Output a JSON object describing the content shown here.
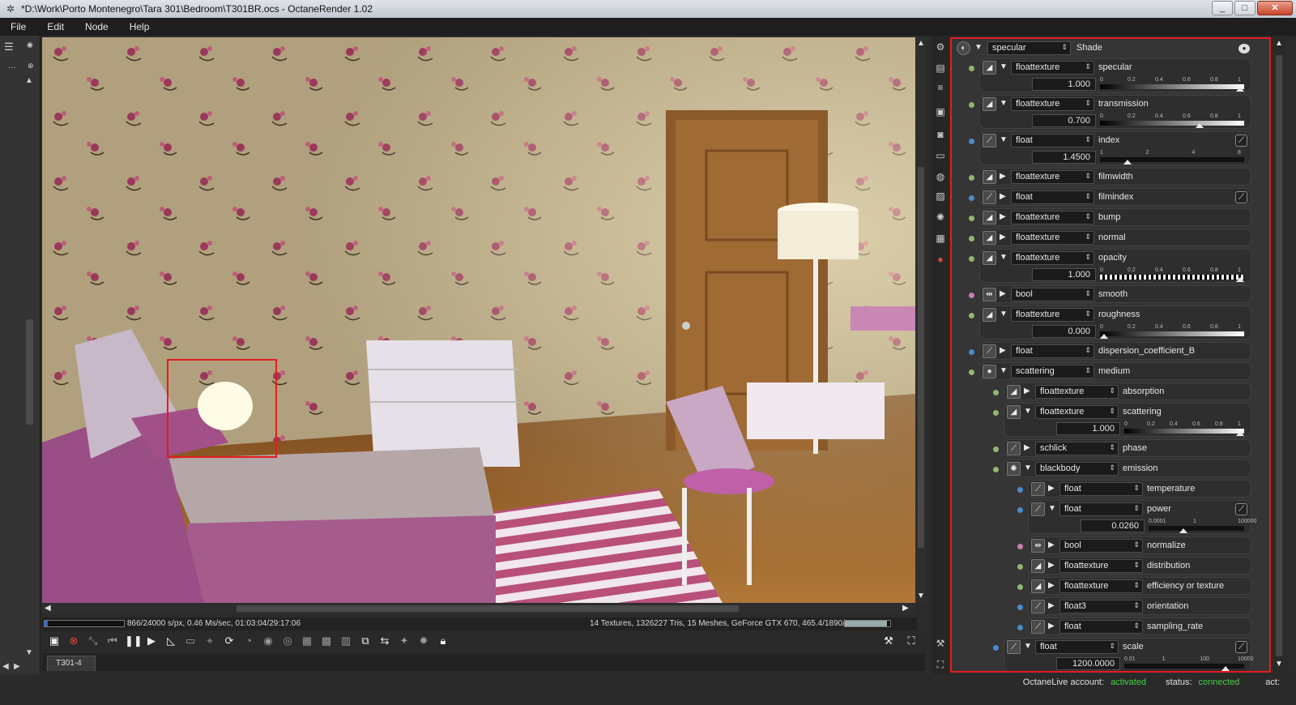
{
  "window": {
    "title": "*D:\\Work\\Porto Montenegro\\Tara 301\\Bedroom\\T301BR.ocs - OctaneRender 1.02",
    "min": "_",
    "max": "□",
    "close": "✕"
  },
  "menu": [
    "File",
    "Edit",
    "Node",
    "Help"
  ],
  "status": {
    "progress_fraction": 0.036,
    "left_text": "866/24000 s/px, 0.46 Ms/sec, 01:03:04/29:17:06",
    "right_text": "14 Textures, 1326227 Tris, 15 Meshes, GeForce GTX 670, 465.4/1890/2048 MB",
    "gpu_mem_fraction": 0.92
  },
  "tab": {
    "label": "T301-4"
  },
  "footer": {
    "account_label": "OctaneLive account:",
    "account_value": "activated",
    "status_label": "status:",
    "status_value": "connected",
    "act_label": "act:"
  },
  "panel": {
    "root": {
      "type": "specular",
      "label": "Shade"
    },
    "rows": [
      {
        "type": "floattexture",
        "label": "specular",
        "expanded": true,
        "value": "1.000",
        "slider": "grad",
        "knob": 1.0,
        "ticks": [
          "0",
          "0.2",
          "0.4",
          "0.6",
          "0.8",
          "1"
        ]
      },
      {
        "type": "floattexture",
        "label": "transmission",
        "expanded": true,
        "value": "0.700",
        "slider": "grad",
        "knob": 0.7,
        "ticks": [
          "0",
          "0.2",
          "0.4",
          "0.6",
          "0.8",
          "1"
        ]
      },
      {
        "type": "float",
        "label": "index",
        "expanded": true,
        "value": "1.4500",
        "slider": "dark",
        "knob": 0.17,
        "ticks": [
          "1",
          "2",
          "4",
          "8"
        ],
        "curve": true
      },
      {
        "type": "floattexture",
        "label": "filmwidth"
      },
      {
        "type": "float",
        "label": "filmindex",
        "curve": true
      },
      {
        "type": "floattexture",
        "label": "bump"
      },
      {
        "type": "floattexture",
        "label": "normal"
      },
      {
        "type": "floattexture",
        "label": "opacity",
        "expanded": true,
        "value": "1.000",
        "slider": "check",
        "knob": 1.0,
        "ticks": [
          "0",
          "0.2",
          "0.4",
          "0.6",
          "0.8",
          "1"
        ]
      },
      {
        "type": "bool",
        "label": "smooth"
      },
      {
        "type": "floattexture",
        "label": "roughness",
        "expanded": true,
        "value": "0.000",
        "slider": "grad",
        "knob": 0.0,
        "ticks": [
          "0",
          "0.2",
          "0.4",
          "0.6",
          "0.8",
          "1"
        ]
      },
      {
        "type": "float",
        "label": "dispersion_coefficient_B"
      },
      {
        "type": "scattering",
        "label": "medium",
        "expanded": true,
        "header": true
      },
      {
        "type": "floattexture",
        "label": "absorption",
        "indent": 1
      },
      {
        "type": "floattexture",
        "label": "scattering",
        "indent": 1,
        "expanded": true,
        "value": "1.000",
        "slider": "grad",
        "knob": 1.0,
        "ticks": [
          "0",
          "0.2",
          "0.4",
          "0.6",
          "0.8",
          "1"
        ]
      },
      {
        "type": "schlick",
        "label": "phase",
        "indent": 1
      },
      {
        "type": "blackbody",
        "label": "emission",
        "indent": 1,
        "expanded": true,
        "header": true
      },
      {
        "type": "float",
        "label": "temperature",
        "indent": 2
      },
      {
        "type": "float",
        "label": "power",
        "indent": 2,
        "expanded": true,
        "value": "0.0260",
        "slider": "dark",
        "knob": 0.35,
        "ticks": [
          "0.0001",
          "1",
          "100000"
        ],
        "curve": true
      },
      {
        "type": "bool",
        "label": "normalize",
        "indent": 2
      },
      {
        "type": "floattexture",
        "label": "distribution",
        "indent": 2
      },
      {
        "type": "floattexture",
        "label": "efficiency or texture",
        "indent": 2
      },
      {
        "type": "float3",
        "label": "orientation",
        "indent": 2
      },
      {
        "type": "float",
        "label": "sampling_rate",
        "indent": 2
      },
      {
        "type": "float",
        "label": "scale",
        "indent": 1,
        "expanded": true,
        "value": "1200.0000",
        "slider": "dark",
        "knob": 0.87,
        "ticks": [
          "0.01",
          "1",
          "100",
          "10000"
        ],
        "curve": true
      }
    ]
  },
  "colors": {
    "highlight_border": "#e21d1d",
    "dot_float": "#4a8cc9",
    "dot_texture": "#8fb870",
    "dot_bool": "#c77fb4",
    "activated": "#45d045"
  }
}
